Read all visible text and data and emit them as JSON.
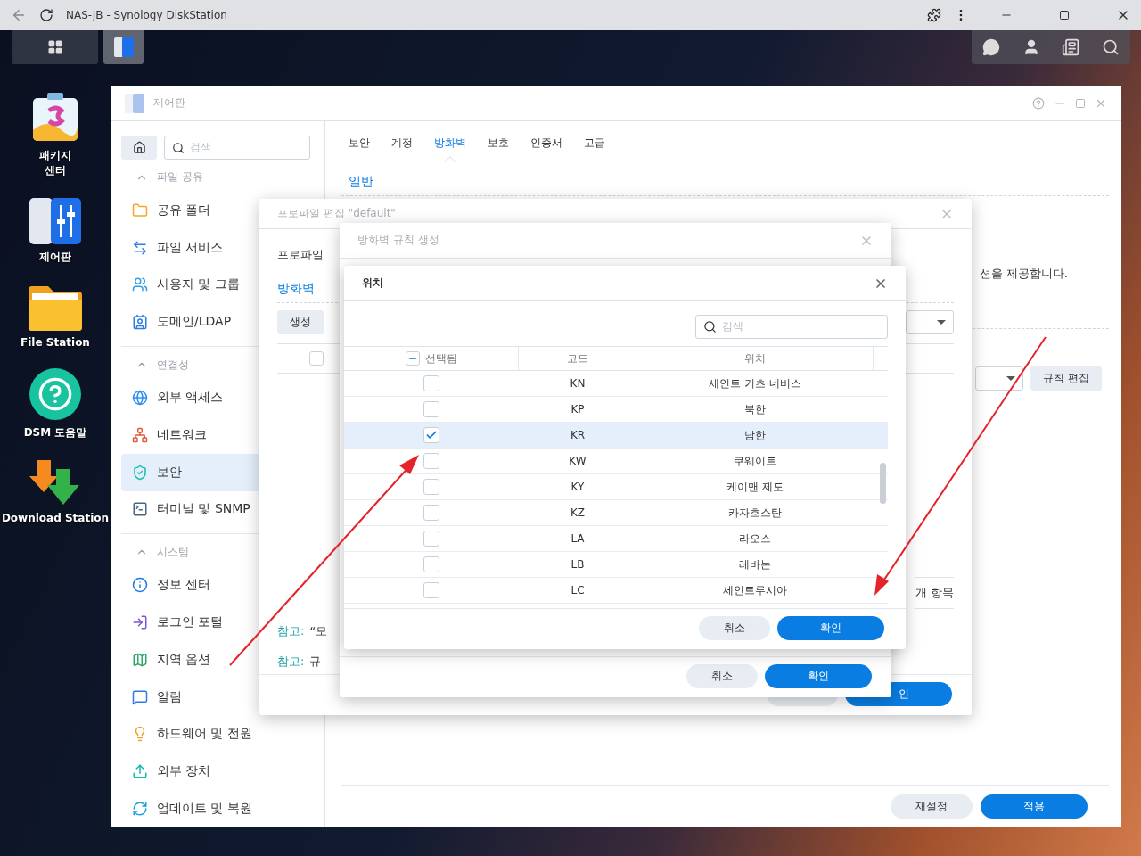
{
  "browser": {
    "title": "NAS-JB - Synology DiskStation"
  },
  "desktop_icons": [
    {
      "label": "패키지\n센터"
    },
    {
      "label": "제어판"
    },
    {
      "label": "File Station"
    },
    {
      "label": "DSM 도움말"
    },
    {
      "label": "Download Station"
    }
  ],
  "control_panel": {
    "title": "제어판",
    "search": {
      "placeholder": "검색"
    },
    "sidebar": [
      {
        "title": "파일 공유",
        "expanded": true,
        "items": [
          {
            "label": "공유 폴더",
            "selected": false
          },
          {
            "label": "파일 서비스",
            "selected": false
          },
          {
            "label": "사용자 및 그룹",
            "selected": false
          },
          {
            "label": "도메인/LDAP",
            "selected": false
          }
        ]
      },
      {
        "title": "연결성",
        "expanded": true,
        "items": [
          {
            "label": "외부 액세스",
            "selected": false
          },
          {
            "label": "네트워크",
            "selected": false
          },
          {
            "label": "보안",
            "selected": true
          },
          {
            "label": "터미널 및 SNMP",
            "selected": false
          }
        ]
      },
      {
        "title": "시스템",
        "expanded": true,
        "items": [
          {
            "label": "정보 센터",
            "selected": false
          },
          {
            "label": "로그인 포털",
            "selected": false
          },
          {
            "label": "지역 옵션",
            "selected": false
          },
          {
            "label": "알림",
            "selected": false
          },
          {
            "label": "하드웨어 및 전원",
            "selected": false
          },
          {
            "label": "외부 장치",
            "selected": false
          },
          {
            "label": "업데이트 및 복원",
            "selected": false
          }
        ]
      }
    ],
    "tabs": [
      {
        "label": "보안",
        "selected": false
      },
      {
        "label": "계정",
        "selected": false
      },
      {
        "label": "방화벽",
        "selected": true
      },
      {
        "label": "보호",
        "selected": false
      },
      {
        "label": "인증서",
        "selected": false
      },
      {
        "label": "고급",
        "selected": false
      }
    ],
    "section": "일반",
    "description": "션을 제공합니다.",
    "edit_button": "규칙 편집",
    "reset_button": "재설정",
    "apply_button": "적용"
  },
  "profile_dialog": {
    "title": "프로파일 편집 \"default\"",
    "label": "프로파일",
    "tab": "방화벽",
    "create_button": "생성",
    "select_all": {
      "checked": false
    },
    "count": "개 항목",
    "notes": [
      {
        "label": "참고:",
        "text": "“모"
      },
      {
        "label": "참고:",
        "text": "규"
      }
    ],
    "confirm_button": "인"
  },
  "rule_dialog": {
    "title": "방화벽 규칙 생성",
    "cancel_button": "취소",
    "confirm_button": "확인"
  },
  "location_dialog": {
    "title": "위치",
    "search": {
      "placeholder": "검색"
    },
    "select_all": {
      "indeterminate": true
    },
    "columns": [
      {
        "label": "선택됨"
      },
      {
        "label": "코드"
      },
      {
        "label": "위치"
      }
    ],
    "rows": [
      {
        "code": "KN",
        "name": "세인트 키츠 네비스",
        "checked": false,
        "selected": false
      },
      {
        "code": "KP",
        "name": "북한",
        "checked": false,
        "selected": false
      },
      {
        "code": "KR",
        "name": "남한",
        "checked": true,
        "selected": true
      },
      {
        "code": "KW",
        "name": "쿠웨이트",
        "checked": false,
        "selected": false
      },
      {
        "code": "KY",
        "name": "케이맨 제도",
        "checked": false,
        "selected": false
      },
      {
        "code": "KZ",
        "name": "카자흐스탄",
        "checked": false,
        "selected": false
      },
      {
        "code": "LA",
        "name": "라오스",
        "checked": false,
        "selected": false
      },
      {
        "code": "LB",
        "name": "레바논",
        "checked": false,
        "selected": false
      },
      {
        "code": "LC",
        "name": "세인트루시아",
        "checked": false,
        "selected": false
      }
    ],
    "cancel_button": "취소",
    "confirm_button": "확인"
  }
}
